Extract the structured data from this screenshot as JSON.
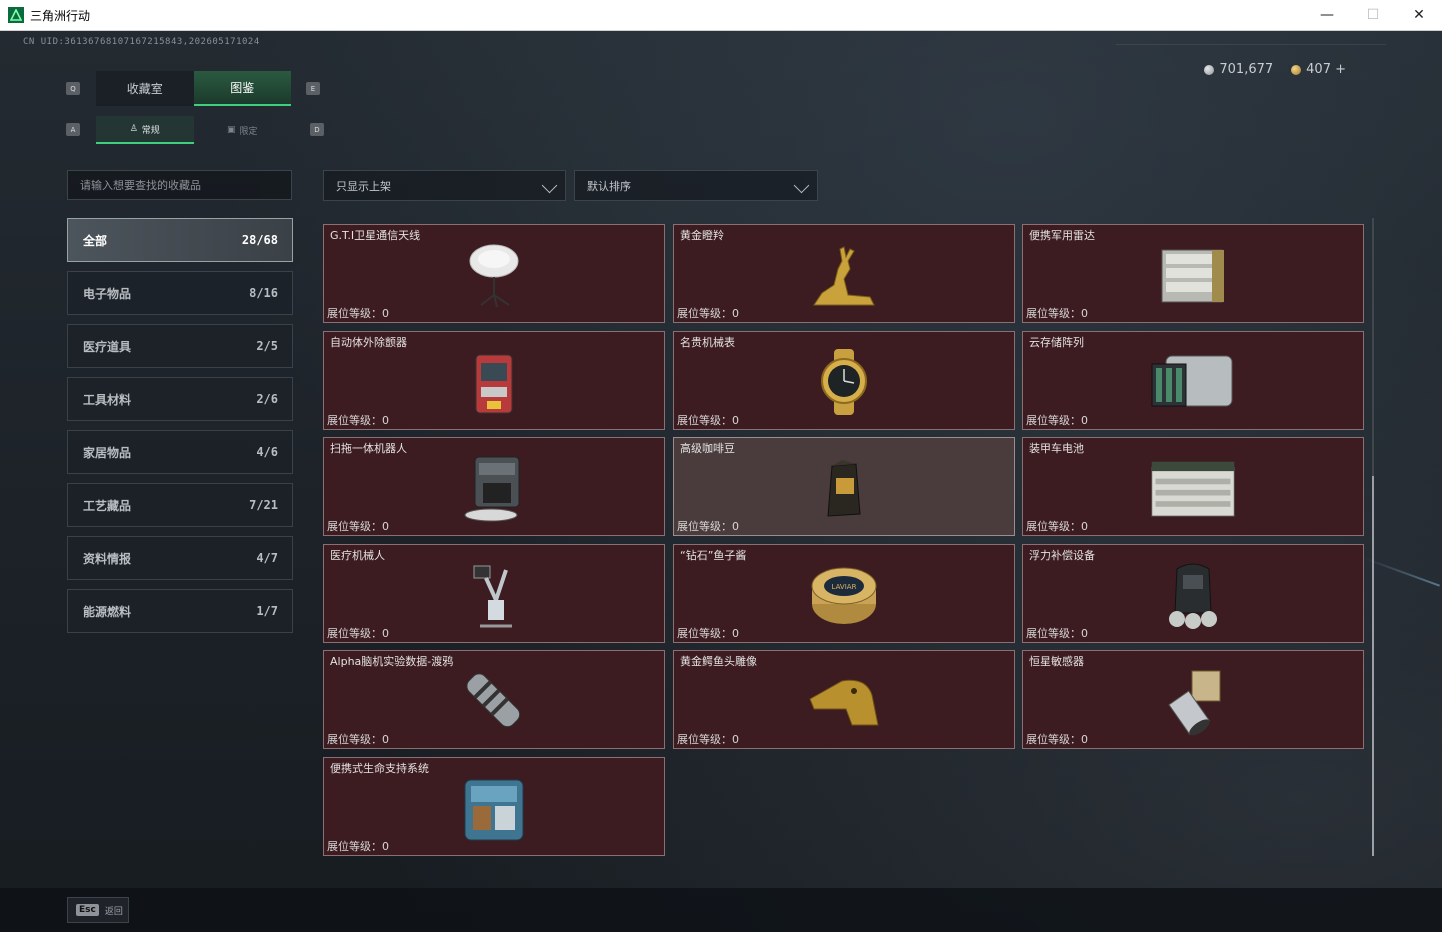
{
  "window": {
    "title": "三角洲行动",
    "minimize": "—",
    "maximize": "☐",
    "close": "✕"
  },
  "uid": "CN UID:361367681071672158​43,202605171024",
  "currency": {
    "silver": "701,677",
    "gold": "407 +"
  },
  "tabs": [
    {
      "label": "收藏室",
      "active": false
    },
    {
      "label": "图鉴",
      "active": true
    }
  ],
  "tab_keys": {
    "left": "Q",
    "right": "E"
  },
  "subtabs": [
    {
      "label": "常规",
      "icon": "figure-icon",
      "active": true
    },
    {
      "label": "限定",
      "icon": "card-icon",
      "active": false
    }
  ],
  "subtab_keys": {
    "left": "A",
    "right": "D"
  },
  "search": {
    "placeholder": "请输入想要查找的收藏品"
  },
  "filter_dropdown": {
    "value": "只显示上架"
  },
  "sort_dropdown": {
    "value": "默认排序"
  },
  "categories": [
    {
      "label": "全部",
      "count": "28/68",
      "active": true
    },
    {
      "label": "电子物品",
      "count": "8/16"
    },
    {
      "label": "医疗道具",
      "count": "2/5"
    },
    {
      "label": "工具材料",
      "count": "2/6"
    },
    {
      "label": "家居物品",
      "count": "4/6"
    },
    {
      "label": "工艺藏品",
      "count": "7/21"
    },
    {
      "label": "资料情报",
      "count": "4/7"
    },
    {
      "label": "能源燃料",
      "count": "1/7"
    }
  ],
  "level_label": "展位等级：",
  "items": [
    {
      "name": "G.T.I卫星通信天线",
      "level": "0",
      "icon": "satellite-dish-icon"
    },
    {
      "name": "黄金瞪羚",
      "level": "0",
      "icon": "golden-gazelle-icon"
    },
    {
      "name": "便携军用雷达",
      "level": "0",
      "icon": "radar-icon"
    },
    {
      "name": "自动体外除颤器",
      "level": "0",
      "icon": "defibrillator-icon"
    },
    {
      "name": "名贵机械表",
      "level": "0",
      "icon": "watch-icon"
    },
    {
      "name": "云存储阵列",
      "level": "0",
      "icon": "storage-array-icon"
    },
    {
      "name": "扫拖一体机器人",
      "level": "0",
      "icon": "robot-vacuum-icon"
    },
    {
      "name": "高级咖啡豆",
      "level": "0",
      "icon": "coffee-bag-icon",
      "highlight": true
    },
    {
      "name": "装甲车电池",
      "level": "0",
      "icon": "battery-icon"
    },
    {
      "name": "医疗机械人",
      "level": "0",
      "icon": "medical-robot-icon"
    },
    {
      "name": "“钻石”鱼子酱",
      "level": "0",
      "icon": "caviar-tin-icon"
    },
    {
      "name": "浮力补偿设备",
      "level": "0",
      "icon": "buoyancy-device-icon"
    },
    {
      "name": "Alpha脑机实验数据-渡鸦",
      "level": "0",
      "icon": "data-capsule-icon"
    },
    {
      "name": "黄金鳄鱼头雕像",
      "level": "0",
      "icon": "crocodile-head-icon"
    },
    {
      "name": "恒星敏感器",
      "level": "0",
      "icon": "star-sensor-icon"
    },
    {
      "name": "便携式生命支持系统",
      "level": "0",
      "icon": "life-support-icon"
    }
  ],
  "caviar_label": "LAVIAR",
  "esc": {
    "key": "Esc",
    "label": "返回"
  }
}
